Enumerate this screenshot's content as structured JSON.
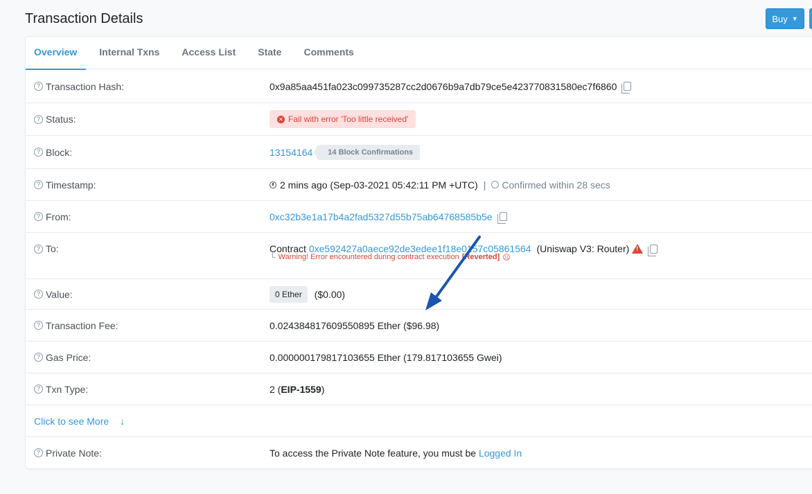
{
  "page": {
    "title": "Transaction Details"
  },
  "header": {
    "buy_label": "Buy"
  },
  "tabs": [
    "Overview",
    "Internal Txns",
    "Access List",
    "State",
    "Comments"
  ],
  "rows": {
    "tx_hash": {
      "label": "Transaction Hash:",
      "value": "0x9a85aa451fa023c099735287cc2d0676b9a7db79ce5e423770831580ec7f6860"
    },
    "status": {
      "label": "Status:",
      "value": "Fail with error 'Too little received'"
    },
    "block": {
      "label": "Block:",
      "number": "13154164",
      "confirmations": "14 Block Confirmations"
    },
    "timestamp": {
      "label": "Timestamp:",
      "value": "2 mins ago (Sep-03-2021 05:42:11 PM +UTC)",
      "separator": "|",
      "confirmed": "Confirmed within 28 secs"
    },
    "from": {
      "label": "From:",
      "address": "0xc32b3e1a17b4a2fad5327d55b75ab64768585b5e"
    },
    "to": {
      "label": "To:",
      "prefix": "Contract",
      "address": "0xe592427a0aece92de3edee1f18e0157c05861564",
      "name": "(Uniswap V3: Router)",
      "warning": "Warning! Error encountered during contract execution",
      "reverted": "[Reverted]"
    },
    "value": {
      "label": "Value:",
      "badge": "0 Ether",
      "usd": "($0.00)"
    },
    "fee": {
      "label": "Transaction Fee:",
      "value": "0.024384817609550895 Ether ($96.98)"
    },
    "gas_price": {
      "label": "Gas Price:",
      "value": "0.000000179817103655 Ether (179.817103655 Gwei)"
    },
    "txn_type": {
      "label": "Txn Type:",
      "prefix": "2 (",
      "type": "EIP-1559",
      "suffix": ")"
    },
    "more": {
      "label": "Click to see More"
    },
    "private_note": {
      "label": "Private Note:",
      "text": "To access the Private Note feature, you must be ",
      "link": "Logged In"
    }
  },
  "colors": {
    "accent": "#3498db",
    "error": "#de4437",
    "annotation_arrow": "#1a56b0"
  }
}
